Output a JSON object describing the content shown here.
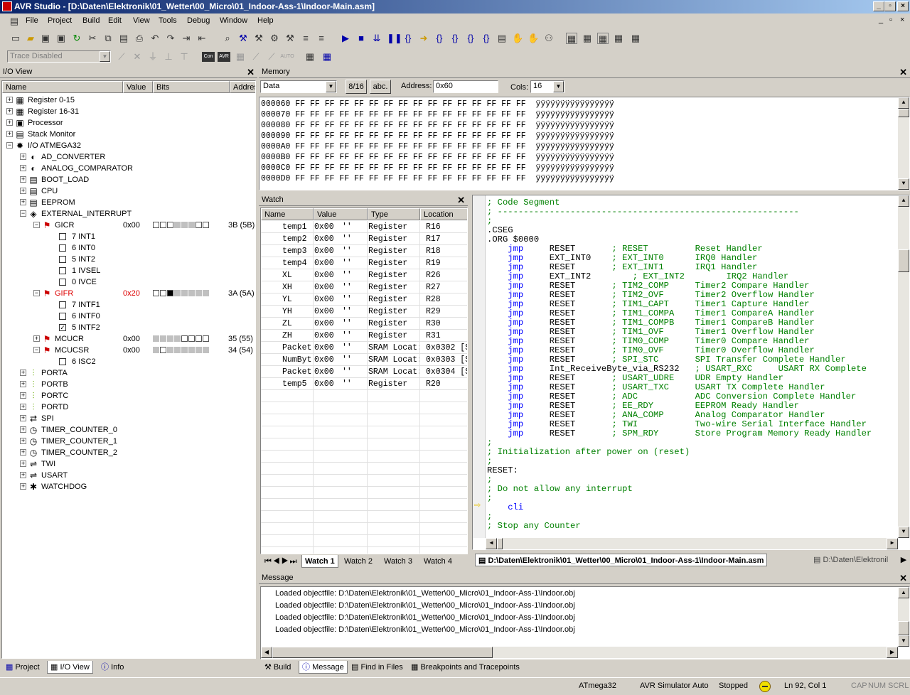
{
  "window": {
    "title": "AVR Studio - [D:\\Daten\\Elektronik\\01_Wetter\\00_Micro\\01_Indoor-Ass-1\\Indoor-Main.asm]"
  },
  "menu": [
    "File",
    "Project",
    "Build",
    "Edit",
    "View",
    "Tools",
    "Debug",
    "Window",
    "Help"
  ],
  "toolbar2": {
    "trace": "Trace Disabled",
    "con": "Con",
    "avr": "AVR",
    "auto": "AUTO"
  },
  "io_view": {
    "title": "I/O View",
    "columns": [
      "Name",
      "Value",
      "Bits",
      "Addres"
    ],
    "rows": [
      {
        "label": "Register 0-15",
        "indent": 0,
        "exp": "+",
        "icon": "register-icon",
        "glyph": "▦"
      },
      {
        "label": "Register 16-31",
        "indent": 0,
        "exp": "+",
        "icon": "register-icon",
        "glyph": "▦"
      },
      {
        "label": "Processor",
        "indent": 0,
        "exp": "+",
        "icon": "processor-icon",
        "glyph": "▣"
      },
      {
        "label": "Stack Monitor",
        "indent": 0,
        "exp": "+",
        "icon": "stack-icon",
        "glyph": "▤"
      },
      {
        "label": "I/O ATMEGA32",
        "indent": 0,
        "exp": "−",
        "icon": "chip-icon",
        "glyph": "✹"
      },
      {
        "label": "AD_CONVERTER",
        "indent": 1,
        "exp": "+",
        "icon": "converter-icon",
        "glyph": "◐"
      },
      {
        "label": "ANALOG_COMPARATOR",
        "indent": 1,
        "exp": "+",
        "icon": "comparator-icon",
        "glyph": "◐"
      },
      {
        "label": "BOOT_LOAD",
        "indent": 1,
        "exp": "+",
        "icon": "module-icon",
        "glyph": "▤"
      },
      {
        "label": "CPU",
        "indent": 1,
        "exp": "+",
        "icon": "module-icon",
        "glyph": "▤"
      },
      {
        "label": "EEPROM",
        "indent": 1,
        "exp": "+",
        "icon": "module-icon",
        "glyph": "▤"
      },
      {
        "label": "EXTERNAL_INTERRUPT",
        "indent": 1,
        "exp": "−",
        "icon": "interrupt-icon",
        "glyph": "◈"
      },
      {
        "label": "GICR",
        "indent": 2,
        "exp": "−",
        "icon": "flag-icon",
        "glyph": "⚑",
        "value": "0x00",
        "bits": "wwwgggww",
        "addr": "3B (5B)"
      },
      {
        "label": "7 INT1",
        "indent": 3,
        "chk": false
      },
      {
        "label": "6 INT0",
        "indent": 3,
        "chk": false
      },
      {
        "label": "5 INT2",
        "indent": 3,
        "chk": false
      },
      {
        "label": "1 IVSEL",
        "indent": 3,
        "chk": false
      },
      {
        "label": "0 IVCE",
        "indent": 3,
        "chk": false
      },
      {
        "label": "GIFR",
        "indent": 2,
        "exp": "−",
        "icon": "flag-icon",
        "glyph": "⚑",
        "value": "0x20",
        "bits": "wwbggggg",
        "addr": "3A (5A)",
        "red": true
      },
      {
        "label": "7 INTF1",
        "indent": 3,
        "chk": false
      },
      {
        "label": "6 INTF0",
        "indent": 3,
        "chk": false
      },
      {
        "label": "5 INTF2",
        "indent": 3,
        "chk": true
      },
      {
        "label": "MCUCR",
        "indent": 2,
        "exp": "+",
        "icon": "flag-icon",
        "glyph": "⚑",
        "value": "0x00",
        "bits": "ggggwwww",
        "addr": "35 (55)"
      },
      {
        "label": "MCUCSR",
        "indent": 2,
        "exp": "−",
        "icon": "flag-icon",
        "glyph": "⚑",
        "value": "0x00",
        "bits": "gwgggggg",
        "addr": "34 (54)"
      },
      {
        "label": "6 ISC2",
        "indent": 3,
        "chk": false
      },
      {
        "label": "PORTA",
        "indent": 1,
        "exp": "+",
        "icon": "port-icon",
        "glyph": "⫶"
      },
      {
        "label": "PORTB",
        "indent": 1,
        "exp": "+",
        "icon": "port-icon",
        "glyph": "⫶"
      },
      {
        "label": "PORTC",
        "indent": 1,
        "exp": "+",
        "icon": "port-icon",
        "glyph": "⫶"
      },
      {
        "label": "PORTD",
        "indent": 1,
        "exp": "+",
        "icon": "port-icon",
        "glyph": "⫶"
      },
      {
        "label": "SPI",
        "indent": 1,
        "exp": "+",
        "icon": "spi-icon",
        "glyph": "⇄"
      },
      {
        "label": "TIMER_COUNTER_0",
        "indent": 1,
        "exp": "+",
        "icon": "timer-icon",
        "glyph": "◷"
      },
      {
        "label": "TIMER_COUNTER_1",
        "indent": 1,
        "exp": "+",
        "icon": "timer-icon",
        "glyph": "◷"
      },
      {
        "label": "TIMER_COUNTER_2",
        "indent": 1,
        "exp": "+",
        "icon": "timer-icon",
        "glyph": "◷"
      },
      {
        "label": "TWI",
        "indent": 1,
        "exp": "+",
        "icon": "twi-icon",
        "glyph": "⇌"
      },
      {
        "label": "USART",
        "indent": 1,
        "exp": "+",
        "icon": "usart-icon",
        "glyph": "⇌"
      },
      {
        "label": "WATCHDOG",
        "indent": 1,
        "exp": "+",
        "icon": "watchdog-icon",
        "glyph": "✱"
      }
    ],
    "tabs": [
      "Project",
      "I/O View",
      "Info"
    ]
  },
  "memory": {
    "title": "Memory",
    "type": "Data",
    "btn_816": "8/16",
    "btn_abc": "abc.",
    "address_label": "Address:",
    "address": "0x60",
    "cols_label": "Cols:",
    "cols": "16",
    "lines": [
      "000060 FF FF FF FF FF FF FF FF FF FF FF FF FF FF FF FF  ÿÿÿÿÿÿÿÿÿÿÿÿÿÿÿÿ",
      "000070 FF FF FF FF FF FF FF FF FF FF FF FF FF FF FF FF  ÿÿÿÿÿÿÿÿÿÿÿÿÿÿÿÿ",
      "000080 FF FF FF FF FF FF FF FF FF FF FF FF FF FF FF FF  ÿÿÿÿÿÿÿÿÿÿÿÿÿÿÿÿ",
      "000090 FF FF FF FF FF FF FF FF FF FF FF FF FF FF FF FF  ÿÿÿÿÿÿÿÿÿÿÿÿÿÿÿÿ",
      "0000A0 FF FF FF FF FF FF FF FF FF FF FF FF FF FF FF FF  ÿÿÿÿÿÿÿÿÿÿÿÿÿÿÿÿ",
      "0000B0 FF FF FF FF FF FF FF FF FF FF FF FF FF FF FF FF  ÿÿÿÿÿÿÿÿÿÿÿÿÿÿÿÿ",
      "0000C0 FF FF FF FF FF FF FF FF FF FF FF FF FF FF FF FF  ÿÿÿÿÿÿÿÿÿÿÿÿÿÿÿÿ",
      "0000D0 FF FF FF FF FF FF FF FF FF FF FF FF FF FF FF FF  ÿÿÿÿÿÿÿÿÿÿÿÿÿÿÿÿ"
    ]
  },
  "watch": {
    "title": "Watch",
    "columns": [
      "Name",
      "Value",
      "Type",
      "Location"
    ],
    "rows": [
      [
        "temp1",
        "0x00",
        "''",
        "Register",
        "R16"
      ],
      [
        "temp2",
        "0x00",
        "''",
        "Register",
        "R17"
      ],
      [
        "temp3",
        "0x00",
        "''",
        "Register",
        "R18"
      ],
      [
        "temp4",
        "0x00",
        "''",
        "Register",
        "R19"
      ],
      [
        "XL",
        "0x00",
        "''",
        "Register",
        "R26"
      ],
      [
        "XH",
        "0x00",
        "''",
        "Register",
        "R27"
      ],
      [
        "YL",
        "0x00",
        "''",
        "Register",
        "R28"
      ],
      [
        "YH",
        "0x00",
        "''",
        "Register",
        "R29"
      ],
      [
        "ZL",
        "0x00",
        "''",
        "Register",
        "R30"
      ],
      [
        "ZH",
        "0x00",
        "''",
        "Register",
        "R31"
      ],
      [
        "Packet",
        "0x00",
        "''",
        "SRAM Locat:",
        "0x0302 [S"
      ],
      [
        "NumByt",
        "0x00",
        "''",
        "SRAM Locat:",
        "0x0303 [S"
      ],
      [
        "Packet",
        "0x00",
        "''",
        "SRAM Locat:",
        "0x0304 [S"
      ],
      [
        "temp5",
        "0x00",
        "''",
        "Register",
        "R20"
      ]
    ],
    "tabs": [
      "Watch 1",
      "Watch 2",
      "Watch 3",
      "Watch 4"
    ]
  },
  "editor": {
    "lines": [
      {
        "t": "; Code Segment",
        "c": "cm"
      },
      {
        "t": "; ----------------------------------------------------------",
        "c": "cm"
      },
      {
        "t": ";",
        "c": "cm"
      },
      {
        "t": ".CSEG",
        "c": ""
      },
      {
        "t": ".ORG $0000",
        "c": ""
      },
      {
        "t": "    jmp     RESET       ; RESET         Reset Handler",
        "c": "j"
      },
      {
        "t": "    jmp     EXT_INT0    ; EXT_INT0      IRQ0 Handler",
        "c": "j"
      },
      {
        "t": "    jmp     RESET       ; EXT_INT1      IRQ1 Handler",
        "c": "j"
      },
      {
        "t": "    jmp     EXT_INT2        ; EXT_INT2        IRQ2 Handler",
        "c": "j"
      },
      {
        "t": "    jmp     RESET       ; TIM2_COMP     Timer2 Compare Handler",
        "c": "j"
      },
      {
        "t": "    jmp     RESET       ; TIM2_OVF      Timer2 Overflow Handler",
        "c": "j"
      },
      {
        "t": "    jmp     RESET       ; TIM1_CAPT     Timer1 Capture Handler",
        "c": "j"
      },
      {
        "t": "    jmp     RESET       ; TIM1_COMPA    Timer1 CompareA Handler",
        "c": "j"
      },
      {
        "t": "    jmp     RESET       ; TIM1_COMPB    Timer1 CompareB Handler",
        "c": "j"
      },
      {
        "t": "    jmp     RESET       ; TIM1_OVF      Timer1 Overflow Handler",
        "c": "j"
      },
      {
        "t": "    jmp     RESET       ; TIM0_COMP     Timer0 Compare Handler",
        "c": "j"
      },
      {
        "t": "    jmp     RESET       ; TIM0_OVF      Timer0 Overflow Handler",
        "c": "j"
      },
      {
        "t": "    jmp     RESET       ; SPI_STC       SPI Transfer Complete Handler",
        "c": "j"
      },
      {
        "t": "    jmp     Int_ReceiveByte_via_RS232   ; USART_RXC     USART RX Complete",
        "c": "j"
      },
      {
        "t": "    jmp     RESET       ; USART_UDRE    UDR Empty Handler",
        "c": "j"
      },
      {
        "t": "    jmp     RESET       ; USART_TXC     USART TX Complete Handler",
        "c": "j"
      },
      {
        "t": "    jmp     RESET       ; ADC           ADC Conversion Complete Handler",
        "c": "j"
      },
      {
        "t": "    jmp     RESET       ; EE_RDY        EEPROM Ready Handler",
        "c": "j"
      },
      {
        "t": "    jmp     RESET       ; ANA_COMP      Analog Comparator Handler",
        "c": "j"
      },
      {
        "t": "    jmp     RESET       ; TWI           Two-wire Serial Interface Handler",
        "c": "j"
      },
      {
        "t": "    jmp     RESET       ; SPM_RDY       Store Program Memory Ready Handler",
        "c": "j"
      },
      {
        "t": ";",
        "c": "cm"
      },
      {
        "t": "; Initialization after power on (reset)",
        "c": "cm"
      },
      {
        "t": ";",
        "c": "cm"
      },
      {
        "t": "RESET:",
        "c": ""
      },
      {
        "t": ";",
        "c": "cm"
      },
      {
        "t": "; Do not allow any interrupt",
        "c": "cm"
      },
      {
        "t": ";",
        "c": "cm"
      },
      {
        "t": "    cli",
        "c": "k"
      },
      {
        "t": ";",
        "c": "cm"
      },
      {
        "t": "; Stop any Counter",
        "c": "cm"
      }
    ],
    "tabs": [
      "D:\\Daten\\Elektronik\\01_Wetter\\00_Micro\\01_Indoor-Ass-1\\Indoor-Main.asm",
      "D:\\Daten\\Elektronil"
    ]
  },
  "message": {
    "title": "Message",
    "lines": [
      "Loaded objectfile: D:\\Daten\\Elektronik\\01_Wetter\\00_Micro\\01_Indoor-Ass-1\\Indoor.obj",
      "Loaded objectfile: D:\\Daten\\Elektronik\\01_Wetter\\00_Micro\\01_Indoor-Ass-1\\Indoor.obj",
      "Loaded objectfile: D:\\Daten\\Elektronik\\01_Wetter\\00_Micro\\01_Indoor-Ass-1\\Indoor.obj",
      "Loaded objectfile: D:\\Daten\\Elektronik\\01_Wetter\\00_Micro\\01_Indoor-Ass-1\\Indoor.obj"
    ],
    "tabs": [
      "Build",
      "Message",
      "Find in Files",
      "Breakpoints and Tracepoints"
    ]
  },
  "status": {
    "device": "ATmega32",
    "platform": "AVR Simulator",
    "mode": "Auto",
    "state": "Stopped",
    "position": "Ln 92, Col 1",
    "cap": "CAP",
    "num": "NUM",
    "scrl": "SCRL"
  }
}
